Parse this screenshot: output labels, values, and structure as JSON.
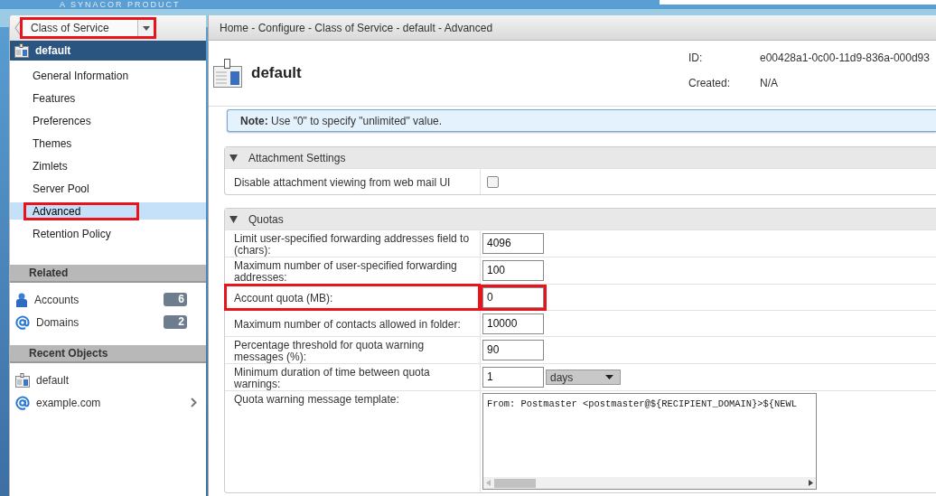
{
  "header": {
    "tagline": "A SYNACOR PRODUCT"
  },
  "sidebar": {
    "dropdown": {
      "value": "Class of Service",
      "highlighted": true
    },
    "object": {
      "name": "default"
    },
    "nav": [
      {
        "label": "General Information",
        "selected": false,
        "highlighted": false
      },
      {
        "label": "Features",
        "selected": false,
        "highlighted": false
      },
      {
        "label": "Preferences",
        "selected": false,
        "highlighted": false
      },
      {
        "label": "Themes",
        "selected": false,
        "highlighted": false
      },
      {
        "label": "Zimlets",
        "selected": false,
        "highlighted": false
      },
      {
        "label": "Server Pool",
        "selected": false,
        "highlighted": false
      },
      {
        "label": "Advanced",
        "selected": true,
        "highlighted": true
      },
      {
        "label": "Retention Policy",
        "selected": false,
        "highlighted": false
      }
    ],
    "related": {
      "title": "Related",
      "items": [
        {
          "kind": "account",
          "label": "Accounts",
          "count": "6"
        },
        {
          "kind": "domain",
          "label": "Domains",
          "count": "2"
        }
      ]
    },
    "recent": {
      "title": "Recent Objects",
      "items": [
        {
          "kind": "cos",
          "label": "default",
          "has_arrow": false
        },
        {
          "kind": "domain",
          "label": "example.com",
          "has_arrow": true
        }
      ]
    }
  },
  "breadcrumb": "Home - Configure - Class of Service - default - Advanced",
  "object_header": {
    "name": "default",
    "fields": [
      {
        "label": "ID:",
        "value": "e00428a1-0c00-11d9-836a-000d93"
      },
      {
        "label": "Created:",
        "value": "N/A"
      }
    ]
  },
  "note": "**Note:** Use \"0\" to specify \"unlimited\" value.",
  "sections": [
    {
      "title": "Attachment Settings",
      "expanded": true,
      "rows": [
        {
          "kind": "checkbox",
          "label": "Disable attachment viewing from web mail UI",
          "checked": false,
          "highlighted": false
        }
      ]
    },
    {
      "title": "Quotas",
      "expanded": true,
      "rows": [
        {
          "kind": "text",
          "label": "Limit user-specified forwarding addresses field to (chars):",
          "value": "4096",
          "highlighted": false
        },
        {
          "kind": "text",
          "label": "Maximum number of user-specified forwarding addresses:",
          "value": "100",
          "highlighted": false
        },
        {
          "kind": "text",
          "label": "Account quota (MB):",
          "value": "0",
          "highlighted": true
        },
        {
          "kind": "text",
          "label": "Maximum number of contacts allowed in folder:",
          "value": "10000",
          "highlighted": false
        },
        {
          "kind": "text",
          "label": "Percentage threshold for quota warning messages (%):",
          "value": "90",
          "highlighted": false
        },
        {
          "kind": "duration",
          "label": "Minimum duration of time between quota warnings:",
          "value": "1",
          "unit": "days",
          "highlighted": false
        },
        {
          "kind": "textarea",
          "label": "Quota warning message template:",
          "value": "From: Postmaster <postmaster@${RECIPIENT_DOMAIN}>${NEWL",
          "highlighted": false
        }
      ]
    }
  ]
}
